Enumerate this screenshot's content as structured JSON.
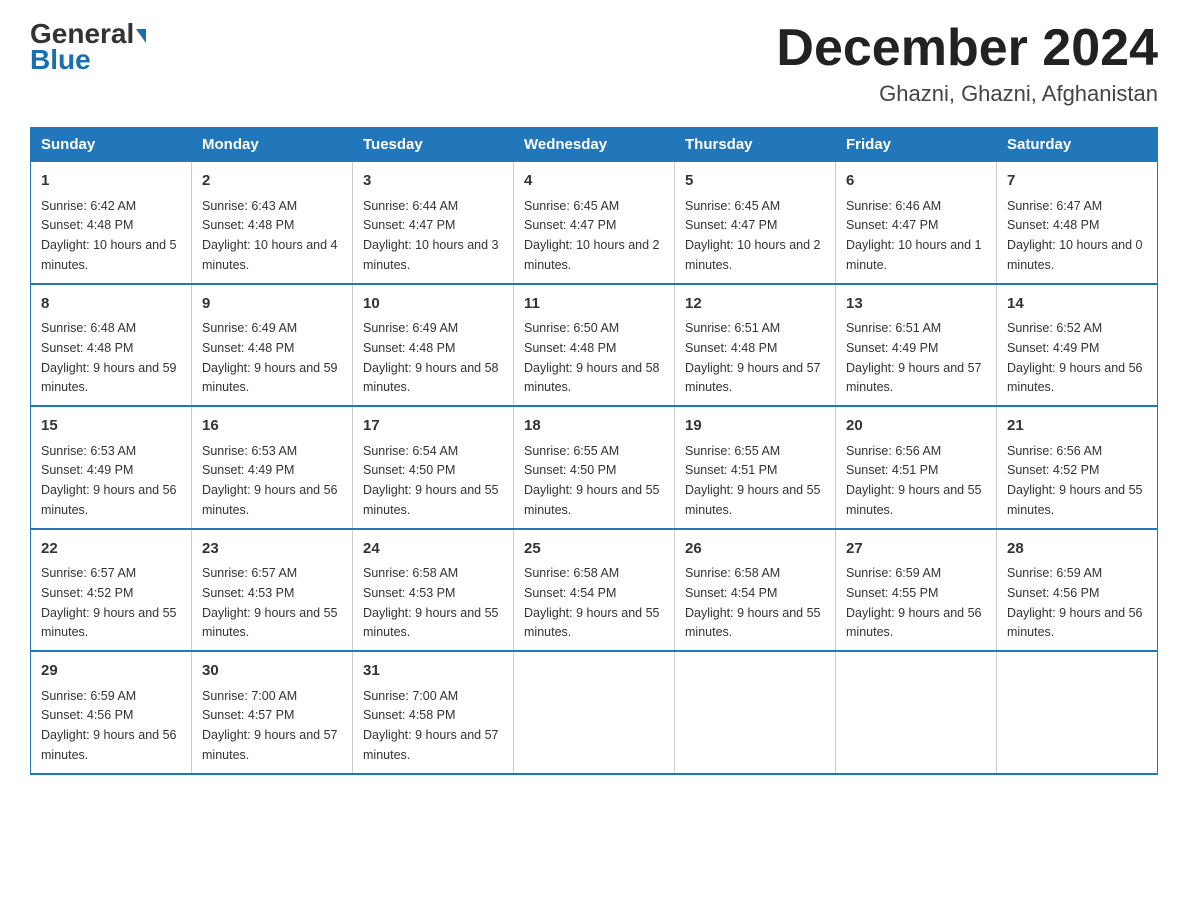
{
  "header": {
    "logo_line1": "General",
    "logo_line2": "Blue",
    "month_title": "December 2024",
    "location": "Ghazni, Ghazni, Afghanistan"
  },
  "days_of_week": [
    "Sunday",
    "Monday",
    "Tuesday",
    "Wednesday",
    "Thursday",
    "Friday",
    "Saturday"
  ],
  "weeks": [
    [
      {
        "day": "1",
        "sunrise": "6:42 AM",
        "sunset": "4:48 PM",
        "daylight": "10 hours and 5 minutes."
      },
      {
        "day": "2",
        "sunrise": "6:43 AM",
        "sunset": "4:48 PM",
        "daylight": "10 hours and 4 minutes."
      },
      {
        "day": "3",
        "sunrise": "6:44 AM",
        "sunset": "4:47 PM",
        "daylight": "10 hours and 3 minutes."
      },
      {
        "day": "4",
        "sunrise": "6:45 AM",
        "sunset": "4:47 PM",
        "daylight": "10 hours and 2 minutes."
      },
      {
        "day": "5",
        "sunrise": "6:45 AM",
        "sunset": "4:47 PM",
        "daylight": "10 hours and 2 minutes."
      },
      {
        "day": "6",
        "sunrise": "6:46 AM",
        "sunset": "4:47 PM",
        "daylight": "10 hours and 1 minute."
      },
      {
        "day": "7",
        "sunrise": "6:47 AM",
        "sunset": "4:48 PM",
        "daylight": "10 hours and 0 minutes."
      }
    ],
    [
      {
        "day": "8",
        "sunrise": "6:48 AM",
        "sunset": "4:48 PM",
        "daylight": "9 hours and 59 minutes."
      },
      {
        "day": "9",
        "sunrise": "6:49 AM",
        "sunset": "4:48 PM",
        "daylight": "9 hours and 59 minutes."
      },
      {
        "day": "10",
        "sunrise": "6:49 AM",
        "sunset": "4:48 PM",
        "daylight": "9 hours and 58 minutes."
      },
      {
        "day": "11",
        "sunrise": "6:50 AM",
        "sunset": "4:48 PM",
        "daylight": "9 hours and 58 minutes."
      },
      {
        "day": "12",
        "sunrise": "6:51 AM",
        "sunset": "4:48 PM",
        "daylight": "9 hours and 57 minutes."
      },
      {
        "day": "13",
        "sunrise": "6:51 AM",
        "sunset": "4:49 PM",
        "daylight": "9 hours and 57 minutes."
      },
      {
        "day": "14",
        "sunrise": "6:52 AM",
        "sunset": "4:49 PM",
        "daylight": "9 hours and 56 minutes."
      }
    ],
    [
      {
        "day": "15",
        "sunrise": "6:53 AM",
        "sunset": "4:49 PM",
        "daylight": "9 hours and 56 minutes."
      },
      {
        "day": "16",
        "sunrise": "6:53 AM",
        "sunset": "4:49 PM",
        "daylight": "9 hours and 56 minutes."
      },
      {
        "day": "17",
        "sunrise": "6:54 AM",
        "sunset": "4:50 PM",
        "daylight": "9 hours and 55 minutes."
      },
      {
        "day": "18",
        "sunrise": "6:55 AM",
        "sunset": "4:50 PM",
        "daylight": "9 hours and 55 minutes."
      },
      {
        "day": "19",
        "sunrise": "6:55 AM",
        "sunset": "4:51 PM",
        "daylight": "9 hours and 55 minutes."
      },
      {
        "day": "20",
        "sunrise": "6:56 AM",
        "sunset": "4:51 PM",
        "daylight": "9 hours and 55 minutes."
      },
      {
        "day": "21",
        "sunrise": "6:56 AM",
        "sunset": "4:52 PM",
        "daylight": "9 hours and 55 minutes."
      }
    ],
    [
      {
        "day": "22",
        "sunrise": "6:57 AM",
        "sunset": "4:52 PM",
        "daylight": "9 hours and 55 minutes."
      },
      {
        "day": "23",
        "sunrise": "6:57 AM",
        "sunset": "4:53 PM",
        "daylight": "9 hours and 55 minutes."
      },
      {
        "day": "24",
        "sunrise": "6:58 AM",
        "sunset": "4:53 PM",
        "daylight": "9 hours and 55 minutes."
      },
      {
        "day": "25",
        "sunrise": "6:58 AM",
        "sunset": "4:54 PM",
        "daylight": "9 hours and 55 minutes."
      },
      {
        "day": "26",
        "sunrise": "6:58 AM",
        "sunset": "4:54 PM",
        "daylight": "9 hours and 55 minutes."
      },
      {
        "day": "27",
        "sunrise": "6:59 AM",
        "sunset": "4:55 PM",
        "daylight": "9 hours and 56 minutes."
      },
      {
        "day": "28",
        "sunrise": "6:59 AM",
        "sunset": "4:56 PM",
        "daylight": "9 hours and 56 minutes."
      }
    ],
    [
      {
        "day": "29",
        "sunrise": "6:59 AM",
        "sunset": "4:56 PM",
        "daylight": "9 hours and 56 minutes."
      },
      {
        "day": "30",
        "sunrise": "7:00 AM",
        "sunset": "4:57 PM",
        "daylight": "9 hours and 57 minutes."
      },
      {
        "day": "31",
        "sunrise": "7:00 AM",
        "sunset": "4:58 PM",
        "daylight": "9 hours and 57 minutes."
      },
      {
        "day": "",
        "sunrise": "",
        "sunset": "",
        "daylight": ""
      },
      {
        "day": "",
        "sunrise": "",
        "sunset": "",
        "daylight": ""
      },
      {
        "day": "",
        "sunrise": "",
        "sunset": "",
        "daylight": ""
      },
      {
        "day": "",
        "sunrise": "",
        "sunset": "",
        "daylight": ""
      }
    ]
  ]
}
